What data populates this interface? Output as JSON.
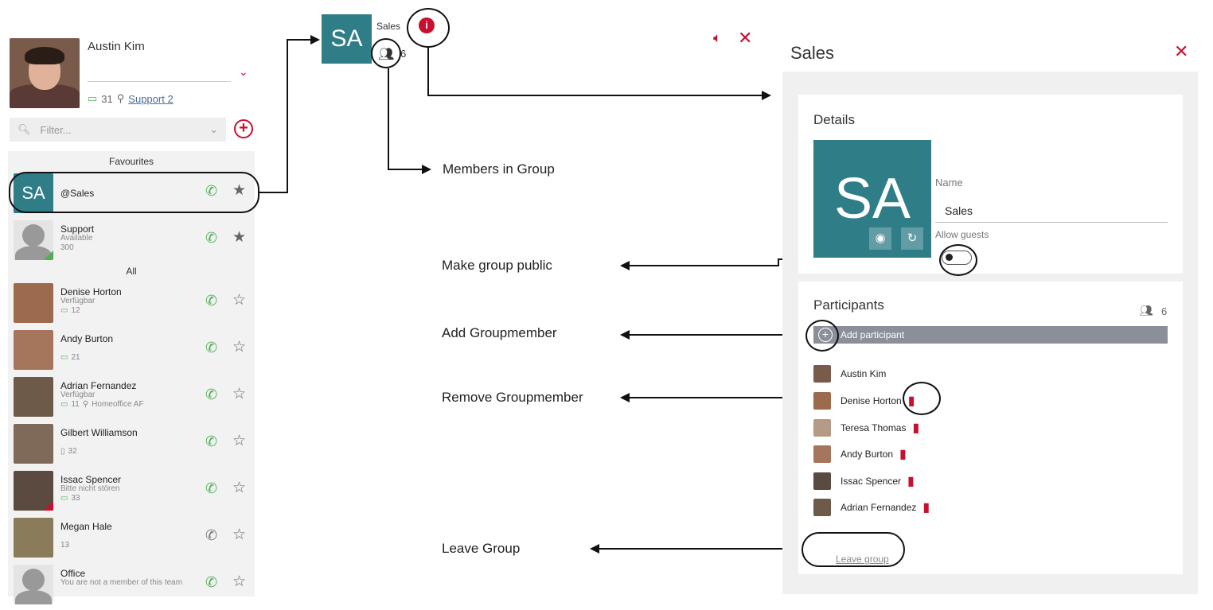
{
  "user": {
    "name": "Austin Kim",
    "device_count": "31",
    "location": "Support 2"
  },
  "filter": {
    "placeholder": "Filter..."
  },
  "sections": {
    "favourites": "Favourites",
    "all": "All"
  },
  "favourites": [
    {
      "initials": "SA",
      "name": "@Sales",
      "sub": "",
      "sub2": ""
    },
    {
      "name": "Support",
      "sub": "Available",
      "sub2": "300"
    }
  ],
  "contacts": [
    {
      "name": "Denise Horton",
      "sub": "Verfügbar",
      "sub2": "12"
    },
    {
      "name": "Andy Burton",
      "sub": "",
      "sub2": "21"
    },
    {
      "name": "Adrian Fernandez",
      "sub": "Verfügbar",
      "sub2": "11",
      "sub3": "Homeoffice AF"
    },
    {
      "name": "Gilbert Williamson",
      "sub": "",
      "sub2": "32"
    },
    {
      "name": "Issac Spencer",
      "sub": "Bitte nicht stören",
      "sub2": "33"
    },
    {
      "name": "Megan Hale",
      "sub": "",
      "sub2": "13"
    },
    {
      "name": "Office",
      "sub": "You are not a member of this team",
      "sub2": ""
    }
  ],
  "group_header": {
    "initials": "SA",
    "name": "Sales",
    "member_count": "6"
  },
  "annotations": {
    "members": "Members in Group",
    "public": "Make group public",
    "add": "Add Groupmember",
    "remove": "Remove Groupmember",
    "leave": "Leave Group"
  },
  "panel": {
    "title": "Sales",
    "details_title": "Details",
    "avatar_initials": "SA",
    "name_label": "Name",
    "name_value": "Sales",
    "allow_guests_label": "Allow guests",
    "participants_title": "Participants",
    "participants_count": "6",
    "add_participant": "Add participant",
    "participants": [
      "Austin Kim",
      "Denise Horton",
      "Teresa Thomas",
      "Andy Burton",
      "Issac Spencer",
      "Adrian Fernandez"
    ],
    "leave_group": "Leave group"
  },
  "colors": {
    "accent": "#c8102e",
    "teal": "#2e7d87",
    "online": "#4caf50"
  }
}
